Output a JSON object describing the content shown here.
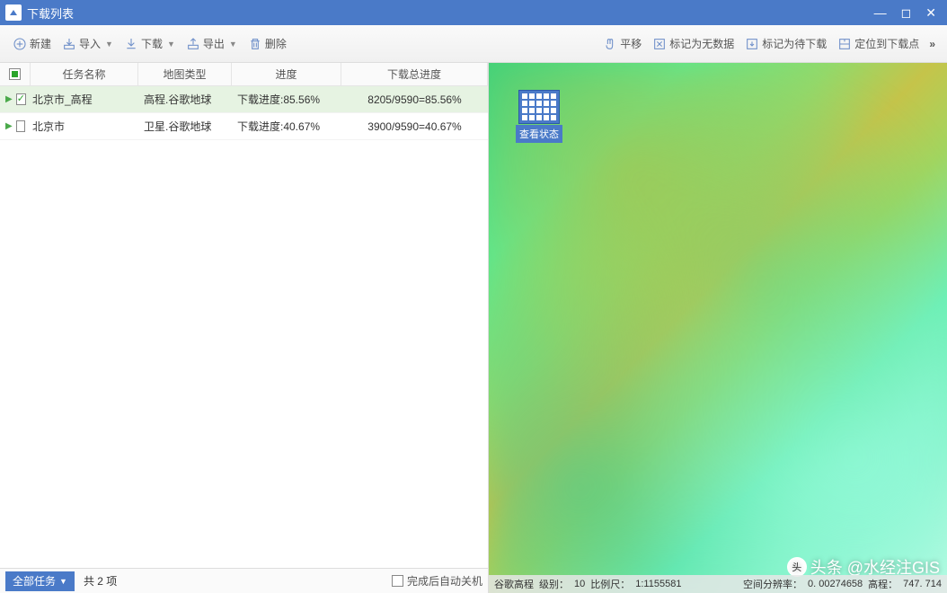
{
  "titlebar": {
    "title": "下载列表"
  },
  "toolbar": {
    "new": "新建",
    "import": "导入",
    "download": "下载",
    "export": "导出",
    "delete": "删除",
    "pan": "平移",
    "mark_nodata": "标记为无数据",
    "mark_pending": "标记为待下载",
    "locate": "定位到下载点",
    "more": "»"
  },
  "grid": {
    "headers": {
      "name": "任务名称",
      "type": "地图类型",
      "progress": "进度",
      "total": "下载总进度"
    },
    "rows": [
      {
        "selected": true,
        "checked": true,
        "name": "北京市_高程",
        "type": "高程.谷歌地球",
        "progress": "下载进度:85.56%",
        "total": "8205/9590=85.56%"
      },
      {
        "selected": false,
        "checked": false,
        "name": "北京市",
        "type": "卫星.谷歌地球",
        "progress": "下载进度:40.67%",
        "total": "3900/9590=40.67%"
      }
    ]
  },
  "bottombar": {
    "all_tasks": "全部任务",
    "count": "共 2 项",
    "auto_shutdown": "完成后自动关机"
  },
  "mapview": {
    "view_status": "查看状态"
  },
  "statusbar": {
    "source": "谷歌高程",
    "level_label": "级别：",
    "level": "10",
    "scale_label": "比例尺：",
    "scale": "1:1155581",
    "res_label": "空间分辨率：",
    "res": "0. 00274658",
    "elev_label": "高程：",
    "elev": "747. 714"
  },
  "watermark": {
    "text": "头条 @水经注GIS"
  }
}
